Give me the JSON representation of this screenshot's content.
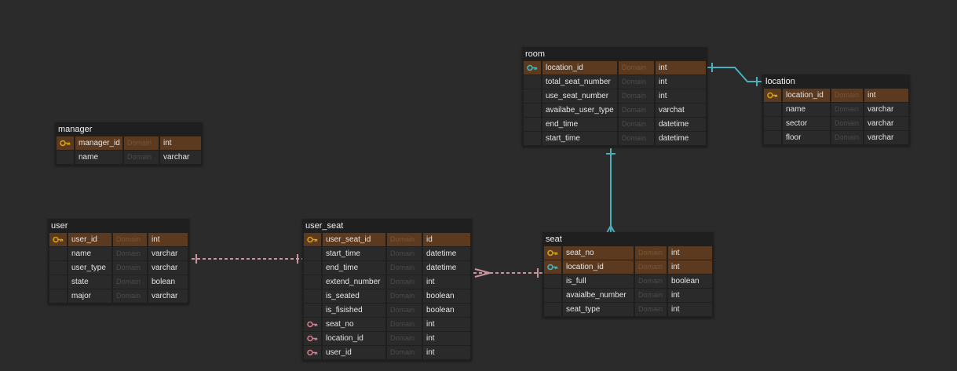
{
  "diagram": {
    "domain_placeholder": "Domain",
    "colors": {
      "background": "#2b2b2b",
      "table_bg": "#1f1f1f",
      "cell_bg": "#2a2a2a",
      "pk_row_bg": "#5c3a1f",
      "pk_key_icon": "#d4a017",
      "fk_key_icon": "#3fb8c4",
      "ref_key_icon": "#d07a8a",
      "solid_relation": "#4ab0bd",
      "dashed_relation": "#c9949c"
    },
    "tables": [
      {
        "id": "room",
        "name": "room",
        "columns": [
          {
            "name": "location_id",
            "type": "int",
            "key": "pfk"
          },
          {
            "name": "total_seat_number",
            "type": "int",
            "key": ""
          },
          {
            "name": "use_seat_number",
            "type": "int",
            "key": ""
          },
          {
            "name": "availabe_user_type",
            "type": "varchat",
            "key": ""
          },
          {
            "name": "end_time",
            "type": "datetime",
            "key": ""
          },
          {
            "name": "start_time",
            "type": "datetime",
            "key": ""
          }
        ]
      },
      {
        "id": "location",
        "name": "location",
        "columns": [
          {
            "name": "location_id",
            "type": "int",
            "key": "pk"
          },
          {
            "name": "name",
            "type": "varchar",
            "key": ""
          },
          {
            "name": "sector",
            "type": "varchar",
            "key": ""
          },
          {
            "name": "floor",
            "type": "varchar",
            "key": ""
          }
        ]
      },
      {
        "id": "manager",
        "name": "manager",
        "columns": [
          {
            "name": "manager_id",
            "type": "int",
            "key": "pk"
          },
          {
            "name": "name",
            "type": "varchar",
            "key": ""
          }
        ]
      },
      {
        "id": "user",
        "name": "user",
        "columns": [
          {
            "name": "user_id",
            "type": "int",
            "key": "pk"
          },
          {
            "name": "name",
            "type": "varchar",
            "key": ""
          },
          {
            "name": "user_type",
            "type": "varchar",
            "key": ""
          },
          {
            "name": "state",
            "type": "bolean",
            "key": ""
          },
          {
            "name": "major",
            "type": "varchar",
            "key": ""
          }
        ]
      },
      {
        "id": "user_seat",
        "name": "user_seat",
        "columns": [
          {
            "name": "user_seat_id",
            "type": "id",
            "key": "pk"
          },
          {
            "name": "start_time",
            "type": "datetime",
            "key": ""
          },
          {
            "name": "end_time",
            "type": "datetime",
            "key": ""
          },
          {
            "name": "extend_number",
            "type": "int",
            "key": ""
          },
          {
            "name": "is_seated",
            "type": "boolean",
            "key": ""
          },
          {
            "name": "is_fisished",
            "type": "boolean",
            "key": ""
          },
          {
            "name": "seat_no",
            "type": "int",
            "key": "ref"
          },
          {
            "name": "location_id",
            "type": "int",
            "key": "ref"
          },
          {
            "name": "user_id",
            "type": "int",
            "key": "ref"
          }
        ]
      },
      {
        "id": "seat",
        "name": "seat",
        "columns": [
          {
            "name": "seat_no",
            "type": "int",
            "key": "pk"
          },
          {
            "name": "location_id",
            "type": "int",
            "key": "pfk"
          },
          {
            "name": "is_full",
            "type": "boolean",
            "key": ""
          },
          {
            "name": "avaialbe_number",
            "type": "int",
            "key": ""
          },
          {
            "name": "seat_type",
            "type": "int",
            "key": ""
          }
        ]
      }
    ],
    "relationships": [
      {
        "from": "room",
        "to": "location",
        "style": "solid"
      },
      {
        "from": "room",
        "to": "seat",
        "style": "solid"
      },
      {
        "from": "user",
        "to": "user_seat",
        "style": "dashed"
      },
      {
        "from": "user_seat",
        "to": "seat",
        "style": "dashed"
      }
    ]
  }
}
